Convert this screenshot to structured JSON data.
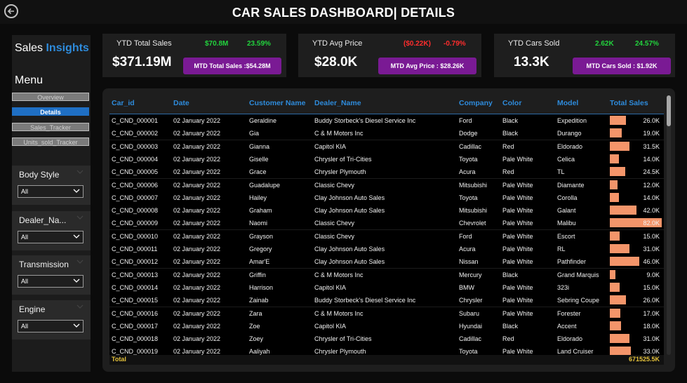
{
  "header": {
    "title": "CAR SALES DASHBOARD| DETAILS"
  },
  "sidebar": {
    "brand_part1": "Sales",
    "brand_part2": "Insights",
    "menu_label": "Menu",
    "nav": [
      {
        "label": "Overview",
        "active": false
      },
      {
        "label": "Details",
        "active": true
      },
      {
        "label": "Sales_Tracker",
        "active": false
      },
      {
        "label": "Units_sold_Tracker",
        "active": false
      }
    ],
    "filters": [
      {
        "label": "Body Style",
        "value": "All"
      },
      {
        "label": "Dealer_Na...",
        "value": "All"
      },
      {
        "label": "Transmission",
        "value": "All"
      },
      {
        "label": "Engine",
        "value": "All"
      }
    ]
  },
  "kpis": [
    {
      "label": "YTD Total Sales",
      "value": "$371.19M",
      "delta_abs": "$70.8M",
      "delta_pct": "23.59%",
      "trend": "up",
      "mtd": "MTD Total Sales :$54.28M"
    },
    {
      "label": "YTD Avg Price",
      "value": "$28.0K",
      "delta_abs": "($0.22K)",
      "delta_pct": "-0.79%",
      "trend": "down",
      "mtd": "MTD Avg Price : $28.26K"
    },
    {
      "label": "YTD Cars Sold",
      "value": "13.3K",
      "delta_abs": "2.62K",
      "delta_pct": "24.57%",
      "trend": "up",
      "mtd": "MTD Cars Sold : $1.92K"
    }
  ],
  "colors": {
    "accent": "#2e8bdb",
    "up": "#22d33d",
    "down": "#ff2d2d",
    "mtd_bg": "#7a1a94",
    "bar": "#f4956a",
    "total": "#e5c23b"
  },
  "table": {
    "columns": [
      "Car_id",
      "Date",
      "Customer Name",
      "Dealer_Name",
      "Company",
      "Color",
      "Model",
      "Total Sales"
    ],
    "rows": [
      [
        "C_CND_000001",
        "02 January 2022",
        "Geraldine",
        "Buddy Storbeck's Diesel Service Inc",
        "Ford",
        "Black",
        "Expedition",
        "26.0K"
      ],
      [
        "C_CND_000002",
        "02 January 2022",
        "Gia",
        "C & M Motors Inc",
        "Dodge",
        "Black",
        "Durango",
        "19.0K"
      ],
      [
        "C_CND_000003",
        "02 January 2022",
        "Gianna",
        "Capitol KIA",
        "Cadillac",
        "Red",
        "Eldorado",
        "31.5K"
      ],
      [
        "C_CND_000004",
        "02 January 2022",
        "Giselle",
        "Chrysler of Tri-Cities",
        "Toyota",
        "Pale White",
        "Celica",
        "14.0K"
      ],
      [
        "C_CND_000005",
        "02 January 2022",
        "Grace",
        "Chrysler Plymouth",
        "Acura",
        "Red",
        "TL",
        "24.5K"
      ],
      [
        "C_CND_000006",
        "02 January 2022",
        "Guadalupe",
        "Classic Chevy",
        "Mitsubishi",
        "Pale White",
        "Diamante",
        "12.0K"
      ],
      [
        "C_CND_000007",
        "02 January 2022",
        "Hailey",
        "Clay Johnson Auto Sales",
        "Toyota",
        "Pale White",
        "Corolla",
        "14.0K"
      ],
      [
        "C_CND_000008",
        "02 January 2022",
        "Graham",
        "Clay Johnson Auto Sales",
        "Mitsubishi",
        "Pale White",
        "Galant",
        "42.0K"
      ],
      [
        "C_CND_000009",
        "02 January 2022",
        "Naomi",
        "Classic Chevy",
        "Chevrolet",
        "Pale White",
        "Malibu",
        "82.0K"
      ],
      [
        "C_CND_000010",
        "02 January 2022",
        "Grayson",
        "Classic Chevy",
        "Ford",
        "Pale White",
        "Escort",
        "15.0K"
      ],
      [
        "C_CND_000011",
        "02 January 2022",
        "Gregory",
        "Clay Johnson Auto Sales",
        "Acura",
        "Pale White",
        "RL",
        "31.0K"
      ],
      [
        "C_CND_000012",
        "02 January 2022",
        "Amar'E",
        "Clay Johnson Auto Sales",
        "Nissan",
        "Pale White",
        "Pathfinder",
        "46.0K"
      ],
      [
        "C_CND_000013",
        "02 January 2022",
        "Griffin",
        "C & M Motors Inc",
        "Mercury",
        "Black",
        "Grand Marquis",
        "9.0K"
      ],
      [
        "C_CND_000014",
        "02 January 2022",
        "Harrison",
        "Capitol KIA",
        "BMW",
        "Pale White",
        "323i",
        "15.0K"
      ],
      [
        "C_CND_000015",
        "02 January 2022",
        "Zainab",
        "Buddy Storbeck's Diesel Service Inc",
        "Chrysler",
        "Pale White",
        "Sebring Coupe",
        "26.0K"
      ],
      [
        "C_CND_000016",
        "02 January 2022",
        "Zara",
        "C & M Motors Inc",
        "Subaru",
        "Pale White",
        "Forester",
        "17.0K"
      ],
      [
        "C_CND_000017",
        "02 January 2022",
        "Zoe",
        "Capitol KIA",
        "Hyundai",
        "Black",
        "Accent",
        "18.0K"
      ],
      [
        "C_CND_000018",
        "02 January 2022",
        "Zoey",
        "Chrysler of Tri-Cities",
        "Cadillac",
        "Red",
        "Eldorado",
        "31.0K"
      ],
      [
        "C_CND_000019",
        "02 January 2022",
        "Aaliyah",
        "Chrysler Plymouth",
        "Toyota",
        "Pale White",
        "Land Cruiser",
        "33.0K"
      ]
    ],
    "sales_values": [
      26.0,
      19.0,
      31.5,
      14.0,
      24.5,
      12.0,
      14.0,
      42.0,
      82.0,
      15.0,
      31.0,
      46.0,
      9.0,
      15.0,
      26.0,
      17.0,
      18.0,
      31.0,
      33.0
    ],
    "sales_max": 82.0,
    "total_label": "Total",
    "total_value": "671525.5K"
  }
}
